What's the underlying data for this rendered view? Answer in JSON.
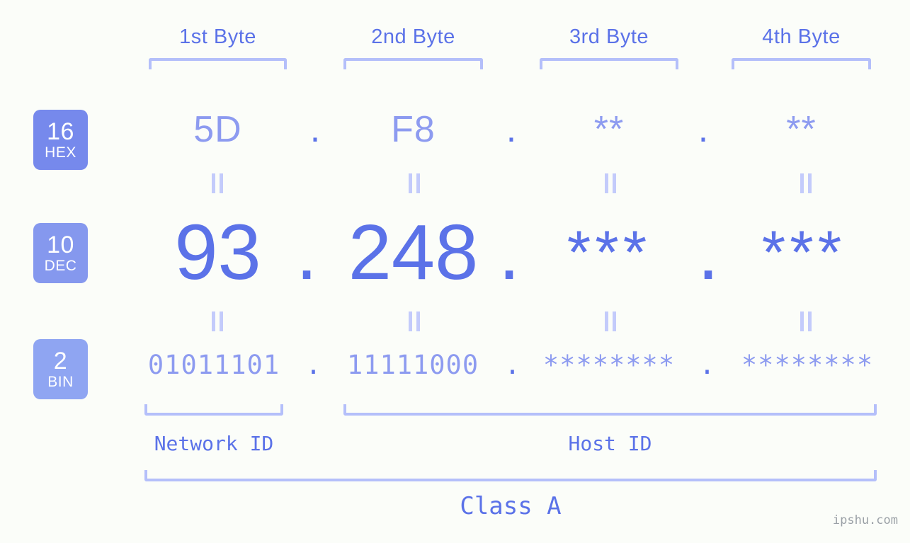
{
  "meta": {
    "background_color": "#fbfdf9",
    "accent_strong": "#5b72e8",
    "accent_light": "#8d9bf0",
    "bracket_color": "#b4bffa",
    "watermark": "ipshu.com"
  },
  "headers": [
    {
      "label": "1st Byte"
    },
    {
      "label": "2nd Byte"
    },
    {
      "label": "3rd Byte"
    },
    {
      "label": "4th Byte"
    }
  ],
  "bases": [
    {
      "number": "16",
      "name": "HEX",
      "color": "#7689ec"
    },
    {
      "number": "10",
      "name": "DEC",
      "color": "#8598ee"
    },
    {
      "number": "2",
      "name": "BIN",
      "color": "#8fa5f2"
    }
  ],
  "rows": {
    "hex": {
      "base_number": "16",
      "base_name": "HEX",
      "values": [
        "5D",
        "F8",
        "**",
        "**"
      ],
      "separators": [
        ".",
        ".",
        "."
      ]
    },
    "dec": {
      "base_number": "10",
      "base_name": "DEC",
      "values": [
        "93",
        "248",
        "***",
        "***"
      ],
      "separators": [
        ".",
        ".",
        "."
      ]
    },
    "bin": {
      "base_number": "2",
      "base_name": "BIN",
      "values": [
        "01011101",
        "11111000",
        "********",
        "********"
      ],
      "separators": [
        ".",
        ".",
        "."
      ]
    }
  },
  "equals_separator": "=",
  "sections": {
    "network_id": "Network ID",
    "host_id": "Host ID",
    "class": "Class A"
  }
}
